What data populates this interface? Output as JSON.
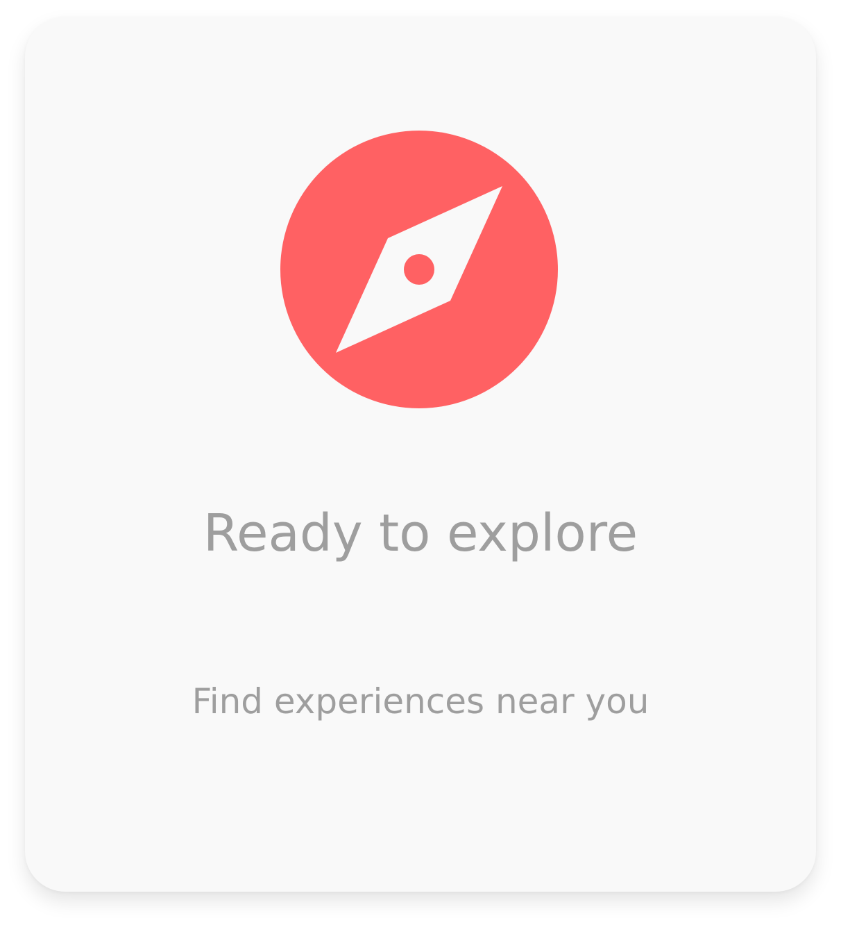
{
  "empty_state": {
    "icon": "compass-icon",
    "title": "Ready to explore",
    "subtitle": "Find experiences near you"
  },
  "colors": {
    "accent": "#ff6163",
    "card_background": "#f9f9f9",
    "text": "#9e9e9e"
  }
}
